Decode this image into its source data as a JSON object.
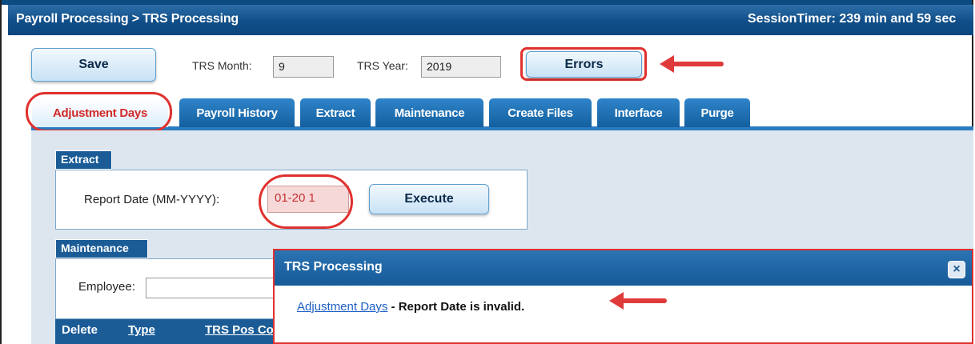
{
  "header": {
    "breadcrumb": "Payroll Processing > TRS Processing",
    "session_timer": "SessionTimer: 239 min and 59 sec"
  },
  "toolbar": {
    "save_label": "Save",
    "trs_month_label": "TRS Month:",
    "trs_month_value": "9",
    "trs_year_label": "TRS Year:",
    "trs_year_value": "2019",
    "errors_label": "Errors"
  },
  "tabs": [
    {
      "label": "Adjustment Days",
      "active": true
    },
    {
      "label": "Payroll History"
    },
    {
      "label": "Extract"
    },
    {
      "label": "Maintenance"
    },
    {
      "label": "Create Files"
    },
    {
      "label": "Interface"
    },
    {
      "label": "Purge"
    }
  ],
  "extract": {
    "section_label": "Extract",
    "report_date_label": "Report Date (MM-YYYY):",
    "report_date_value": "01-20 1",
    "execute_label": "Execute"
  },
  "maintenance": {
    "section_label": "Maintenance",
    "employee_label": "Employee:",
    "employee_value": "",
    "columns": [
      "Delete",
      "Type",
      "TRS Pos Co"
    ]
  },
  "dialog": {
    "title": "TRS Processing",
    "link": "Adjustment Days",
    "message": " - Report Date is invalid.",
    "close_icon": "close-icon"
  },
  "colors": {
    "header_blue": "#104e88",
    "highlight_red": "#e0312e",
    "tab_blue": "#1f6fb2"
  }
}
